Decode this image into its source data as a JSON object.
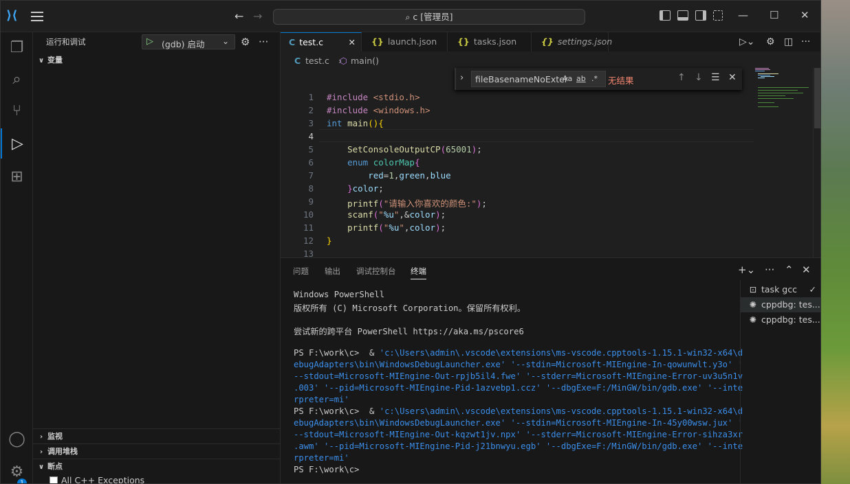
{
  "titlebar": {
    "search_text": "⌕ c [管理员]",
    "back_arrow": "←",
    "forward_arrow": "→",
    "minimize": "—",
    "maximize": "☐",
    "close": "✕"
  },
  "activity_bar": {
    "items": [
      "files-icon",
      "search-icon",
      "source-control-icon",
      "run-debug-icon",
      "extensions-icon"
    ],
    "bottom": [
      "account-icon",
      "settings-gear-icon"
    ],
    "settings_badge": "1"
  },
  "sidebar": {
    "title": "运行和调试",
    "debug_config": "(gdb) 启动",
    "sections": {
      "variables": "变量",
      "watch": "监视",
      "call_stack": "调用堆栈",
      "breakpoints": "断点"
    },
    "breakpoint_item": "All C++ Exceptions"
  },
  "tabs": [
    {
      "icon": "C",
      "label": "test.c",
      "active": true
    },
    {
      "icon": "{}",
      "label": "launch.json"
    },
    {
      "icon": "{}",
      "label": "tasks.json"
    },
    {
      "icon": "{}",
      "label": "settings.json"
    }
  ],
  "breadcrumb": {
    "file_icon": "C",
    "file": "test.c",
    "sep": "›",
    "symbol": "main()"
  },
  "find_widget": {
    "query": "fileBasenameNoExter",
    "opt_case": "Aa",
    "opt_word": "ab",
    "opt_regex": ".*",
    "status": "无结果"
  },
  "editor": {
    "line_numbers": [
      "1",
      "2",
      "3",
      "4",
      "5",
      "6",
      "7",
      "8",
      "9",
      "10",
      "11",
      "12",
      "13"
    ],
    "current_line": 4
  },
  "panel": {
    "tabs": [
      "问题",
      "输出",
      "调试控制台",
      "终端"
    ],
    "active_tab": "终端",
    "terminal_lines": [
      "Windows PowerShell",
      "版权所有 (C) Microsoft Corporation。保留所有权利。",
      "",
      "尝试新的跨平台 PowerShell https://aka.ms/pscore6",
      "",
      "PS F:\\work\\c>  & 'c:\\Users\\admin\\.vscode\\extensions\\ms-vscode.cpptools-1.15.1-win32-x64\\d",
      "ebugAdapters\\bin\\WindowsDebugLauncher.exe' '--stdin=Microsoft-MIEngine-In-qowunwlt.y3o' '",
      "--stdout=Microsoft-MIEngine-Out-rpjb5il4.fwe' '--stderr=Microsoft-MIEngine-Error-uv3u5n1v",
      ".003' '--pid=Microsoft-MIEngine-Pid-1azvebp1.ccz' '--dbgExe=F:/MinGW/bin/gdb.exe' '--inte",
      "rpreter=mi'",
      "PS F:\\work\\c>  & 'c:\\Users\\admin\\.vscode\\extensions\\ms-vscode.cpptools-1.15.1-win32-x64\\d",
      "ebugAdapters\\bin\\WindowsDebugLauncher.exe' '--stdin=Microsoft-MIEngine-In-45y00wsw.jux' '",
      "--stdout=Microsoft-MIEngine-Out-kqzwt1jv.npx' '--stderr=Microsoft-MIEngine-Error-sihza3xr",
      ".awm' '--pid=Microsoft-MIEngine-Pid-j21bnwyu.egb' '--dbgExe=F:/MinGW/bin/gdb.exe' '--inte",
      "rpreter=mi'",
      "PS F:\\work\\c>"
    ],
    "terminal_list": [
      {
        "label": "task gcc",
        "check": "✓"
      },
      {
        "label": "cppdbg: tes..."
      },
      {
        "label": "cppdbg: tes..."
      }
    ]
  }
}
